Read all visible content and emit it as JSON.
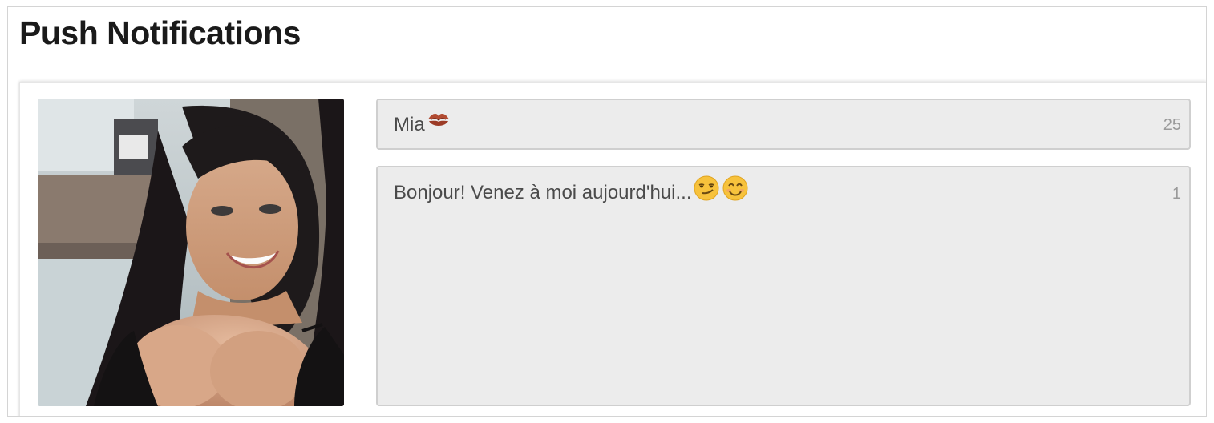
{
  "page": {
    "title": "Push Notifications"
  },
  "notification": {
    "title_text": "Mia",
    "title_emoji": "kiss-mark-icon",
    "title_counter": "25",
    "message_text": "Bonjour! Venez à moi aujourd'hui...",
    "message_emojis": [
      "smirking-face-icon",
      "smiling-face-icon"
    ],
    "message_counter": "1"
  },
  "colors": {
    "field_background": "#ececec",
    "field_border": "#cfcfcf",
    "title_text": "#1a1a1a",
    "field_text": "#4a4a4a",
    "counter_text": "#9a9a9a"
  }
}
